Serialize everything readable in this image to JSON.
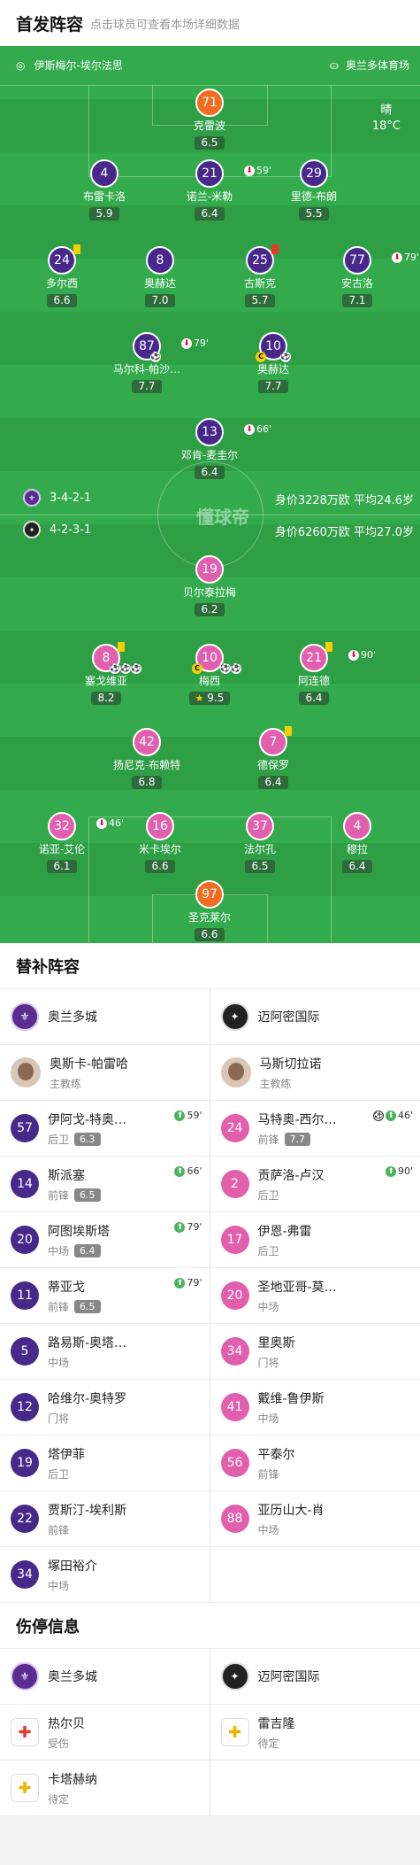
{
  "header": {
    "title": "首发阵容",
    "subtitle": "点击球员可查看本场详细数据"
  },
  "pitch": {
    "home_coach": "伊斯梅尔-埃尔法思",
    "venue": "奥兰多体育场",
    "weather": "晴",
    "temp": "18°C",
    "home_formation": "3-4-2-1",
    "home_value": "身价3228万欧 平均24.6岁",
    "away_formation": "4-2-3-1",
    "away_value": "身价6260万欧 平均27.0岁",
    "watermark": "懂球帝",
    "home_players": [
      {
        "num": "71",
        "name": "克雷波",
        "rating": "6.5",
        "gk": true
      },
      {
        "num": "4",
        "name": "布雷卡洛",
        "rating": "5.9"
      },
      {
        "num": "21",
        "name": "诺兰-米勒",
        "rating": "6.4",
        "sub": "59'"
      },
      {
        "num": "29",
        "name": "里德-布朗",
        "rating": "5.5"
      },
      {
        "num": "24",
        "name": "多尔西",
        "rating": "6.6"
      },
      {
        "num": "8",
        "name": "奥赫达",
        "rating": "7.0"
      },
      {
        "num": "25",
        "name": "古斯克",
        "rating": "5.7"
      },
      {
        "num": "77",
        "name": "安古洛",
        "rating": "7.1",
        "sub": "79'"
      },
      {
        "num": "87",
        "name": "马尔科-帕沙…",
        "rating": "7.7",
        "sub": "79'"
      },
      {
        "num": "10",
        "name": "奥赫达",
        "rating": "7.7"
      },
      {
        "num": "13",
        "name": "邓肯-麦圭尔",
        "rating": "6.4",
        "sub": "66'"
      }
    ],
    "away_players": [
      {
        "num": "19",
        "name": "贝尔泰拉梅",
        "rating": "6.2"
      },
      {
        "num": "8",
        "name": "塞戈维亚",
        "rating": "8.2"
      },
      {
        "num": "10",
        "name": "梅西",
        "rating": "9.5"
      },
      {
        "num": "21",
        "name": "阿连德",
        "rating": "6.4",
        "sub": "90'"
      },
      {
        "num": "42",
        "name": "扬尼克-布赖特",
        "rating": "6.8"
      },
      {
        "num": "7",
        "name": "德保罗",
        "rating": "6.4"
      },
      {
        "num": "32",
        "name": "诺亚-艾伦",
        "rating": "6.1",
        "sub": "46'"
      },
      {
        "num": "16",
        "name": "米卡埃尔",
        "rating": "6.6"
      },
      {
        "num": "37",
        "name": "法尔孔",
        "rating": "6.5"
      },
      {
        "num": "4",
        "name": "穆拉",
        "rating": "6.4"
      },
      {
        "num": "97",
        "name": "圣克莱尔",
        "rating": "6.6",
        "gk": true
      }
    ]
  },
  "subs": {
    "title": "替补阵容",
    "home_team": "奥兰多城",
    "away_team": "迈阿密国际",
    "home_coach": {
      "name": "奥斯卡-帕雷哈",
      "role": "主教练"
    },
    "away_coach": {
      "name": "马斯切拉诺",
      "role": "主教练"
    },
    "home": [
      {
        "num": "57",
        "name": "伊阿戈-特奥…",
        "pos": "后卫",
        "rating": "6.3",
        "ev": "59'"
      },
      {
        "num": "14",
        "name": "斯派塞",
        "pos": "前锋",
        "rating": "6.5",
        "ev": "66'"
      },
      {
        "num": "20",
        "name": "阿图埃斯塔",
        "pos": "中场",
        "rating": "6.4",
        "ev": "79'"
      },
      {
        "num": "11",
        "name": "蒂亚戈",
        "pos": "前锋",
        "rating": "6.5",
        "ev": "79'"
      },
      {
        "num": "5",
        "name": "路易斯-奥塔…",
        "pos": "中场"
      },
      {
        "num": "12",
        "name": "哈维尔-奥特罗",
        "pos": "门将"
      },
      {
        "num": "19",
        "name": "塔伊菲",
        "pos": "后卫"
      },
      {
        "num": "22",
        "name": "贾斯汀-埃利斯",
        "pos": "前锋"
      },
      {
        "num": "34",
        "name": "塚田裕介",
        "pos": "中场"
      }
    ],
    "away": [
      {
        "num": "24",
        "name": "马特奥-西尔…",
        "pos": "前锋",
        "rating": "7.7",
        "ev": "46'"
      },
      {
        "num": "2",
        "name": "贡萨洛-卢汉",
        "pos": "后卫",
        "ev": "90'"
      },
      {
        "num": "17",
        "name": "伊恩-弗雷",
        "pos": "后卫"
      },
      {
        "num": "20",
        "name": "圣地亚哥-莫…",
        "pos": "中场"
      },
      {
        "num": "34",
        "name": "里奥斯",
        "pos": "门将"
      },
      {
        "num": "41",
        "name": "戴维-鲁伊斯",
        "pos": "中场"
      },
      {
        "num": "56",
        "name": "平泰尔",
        "pos": "前锋"
      },
      {
        "num": "88",
        "name": "亚历山大-肖",
        "pos": "中场"
      }
    ]
  },
  "injuries": {
    "title": "伤停信息",
    "home": [
      {
        "name": "热尔贝",
        "status": "受伤"
      },
      {
        "name": "卡塔赫纳",
        "status": "待定"
      }
    ],
    "away": [
      {
        "name": "雷吉隆",
        "status": "待定"
      }
    ]
  }
}
